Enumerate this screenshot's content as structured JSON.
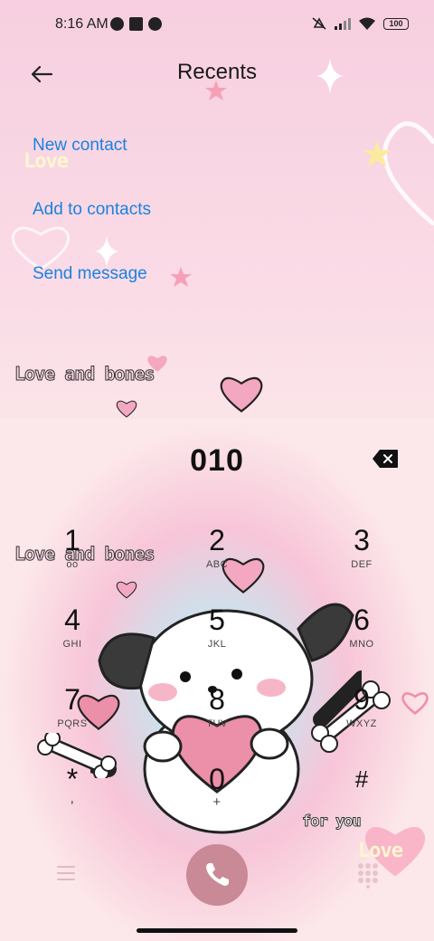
{
  "status_bar": {
    "time": "8:16 AM",
    "battery": "100"
  },
  "header": {
    "title": "Recents",
    "back_icon": "arrow-left-icon"
  },
  "actions": [
    {
      "label": "New contact"
    },
    {
      "label": "Add to contacts"
    },
    {
      "label": "Send message"
    }
  ],
  "decorations": {
    "love_text": "Love",
    "love_and_bones": "Love and bones",
    "for_you": "for you"
  },
  "dialer": {
    "number": "010",
    "keys": [
      {
        "digit": "1",
        "letters": "ᴏᴏ"
      },
      {
        "digit": "2",
        "letters": "ABC"
      },
      {
        "digit": "3",
        "letters": "DEF"
      },
      {
        "digit": "4",
        "letters": "GHI"
      },
      {
        "digit": "5",
        "letters": "JKL"
      },
      {
        "digit": "6",
        "letters": "MNO"
      },
      {
        "digit": "7",
        "letters": "PQRS"
      },
      {
        "digit": "8",
        "letters": "TUV"
      },
      {
        "digit": "9",
        "letters": "WXYZ"
      },
      {
        "digit": "*",
        "letters": ","
      },
      {
        "digit": "0",
        "letters": "+"
      },
      {
        "digit": "#",
        "letters": ""
      }
    ]
  },
  "colors": {
    "link": "#1a82e0",
    "call_button": "#c98996",
    "heart": "#f4a7c0"
  }
}
